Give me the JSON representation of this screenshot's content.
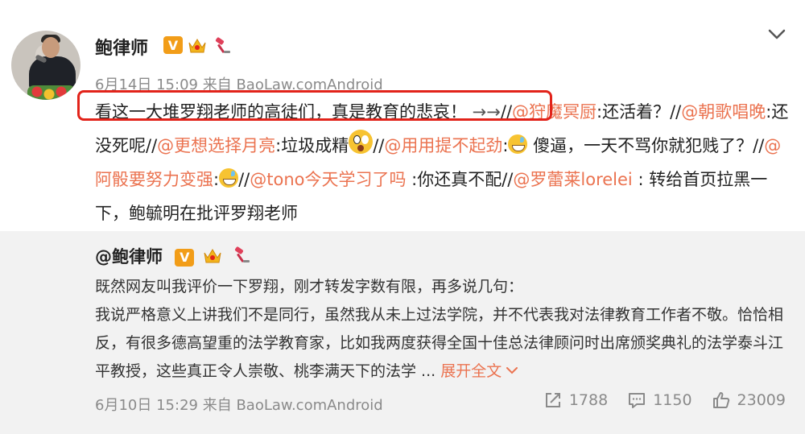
{
  "post": {
    "username": "鲍律师",
    "badges": {
      "verified": "V",
      "crown_icon": "crown-icon",
      "tool_icon": "gavel-icon"
    },
    "date": "6月14日",
    "time": "15:09",
    "source_prefix": "来自",
    "source": "BaoLaw.comAndroid",
    "content": {
      "part1": "看这一大堆罗翔老师的高徒们，真是教育的悲哀！",
      "arrow": " →→",
      "sep1": "//",
      "mention1": "@狩魔冥厨",
      "text1": ":还活着？//",
      "mention2": "@朝歌唱晚",
      "text2": ":还没死呢//",
      "mention3": "@更想选择月亮",
      "text3": ":垃圾成精",
      "sep2": "//",
      "mention4": "@用用提不起劲",
      "text4": ":",
      "text4b": " 傻逼，一天不骂你就犯贱了？//",
      "mention5": "@阿骰要努力变强",
      "text5": ":",
      "sep3": "//",
      "mention6": "@tono今天学习了吗",
      "text6": " :你还真不配//",
      "mention7": "@罗蕾莱lorelei",
      "text7": " : 转给首页拉黑一下，鲍毓明在批评罗翔老师"
    },
    "accent_color": "#eb7350",
    "highlight_color": "#e2231a"
  },
  "repost": {
    "author": "@鲍律师",
    "text_line1": "既然网友叫我评价一下罗翔，刚才转发字数有限，再多说几句：",
    "text_body": "我说严格意义上讲我们不是同行，虽然我从未上过法学院，并不代表我对法律教育工作者不敬。恰恰相反，有很多德高望重的法学教育家，比如我两度获得全国十佳总法律顾问时出席颁奖典礼的法学泰斗江平教授，这些真正令人崇敬、桃李满天下的法学 ...",
    "expand_label": "展开全文",
    "date": "6月10日",
    "time": "15:29",
    "source_prefix": "来自",
    "source": "BaoLaw.comAndroid",
    "reposts": "1788",
    "comments": "1150",
    "likes": "23009"
  }
}
